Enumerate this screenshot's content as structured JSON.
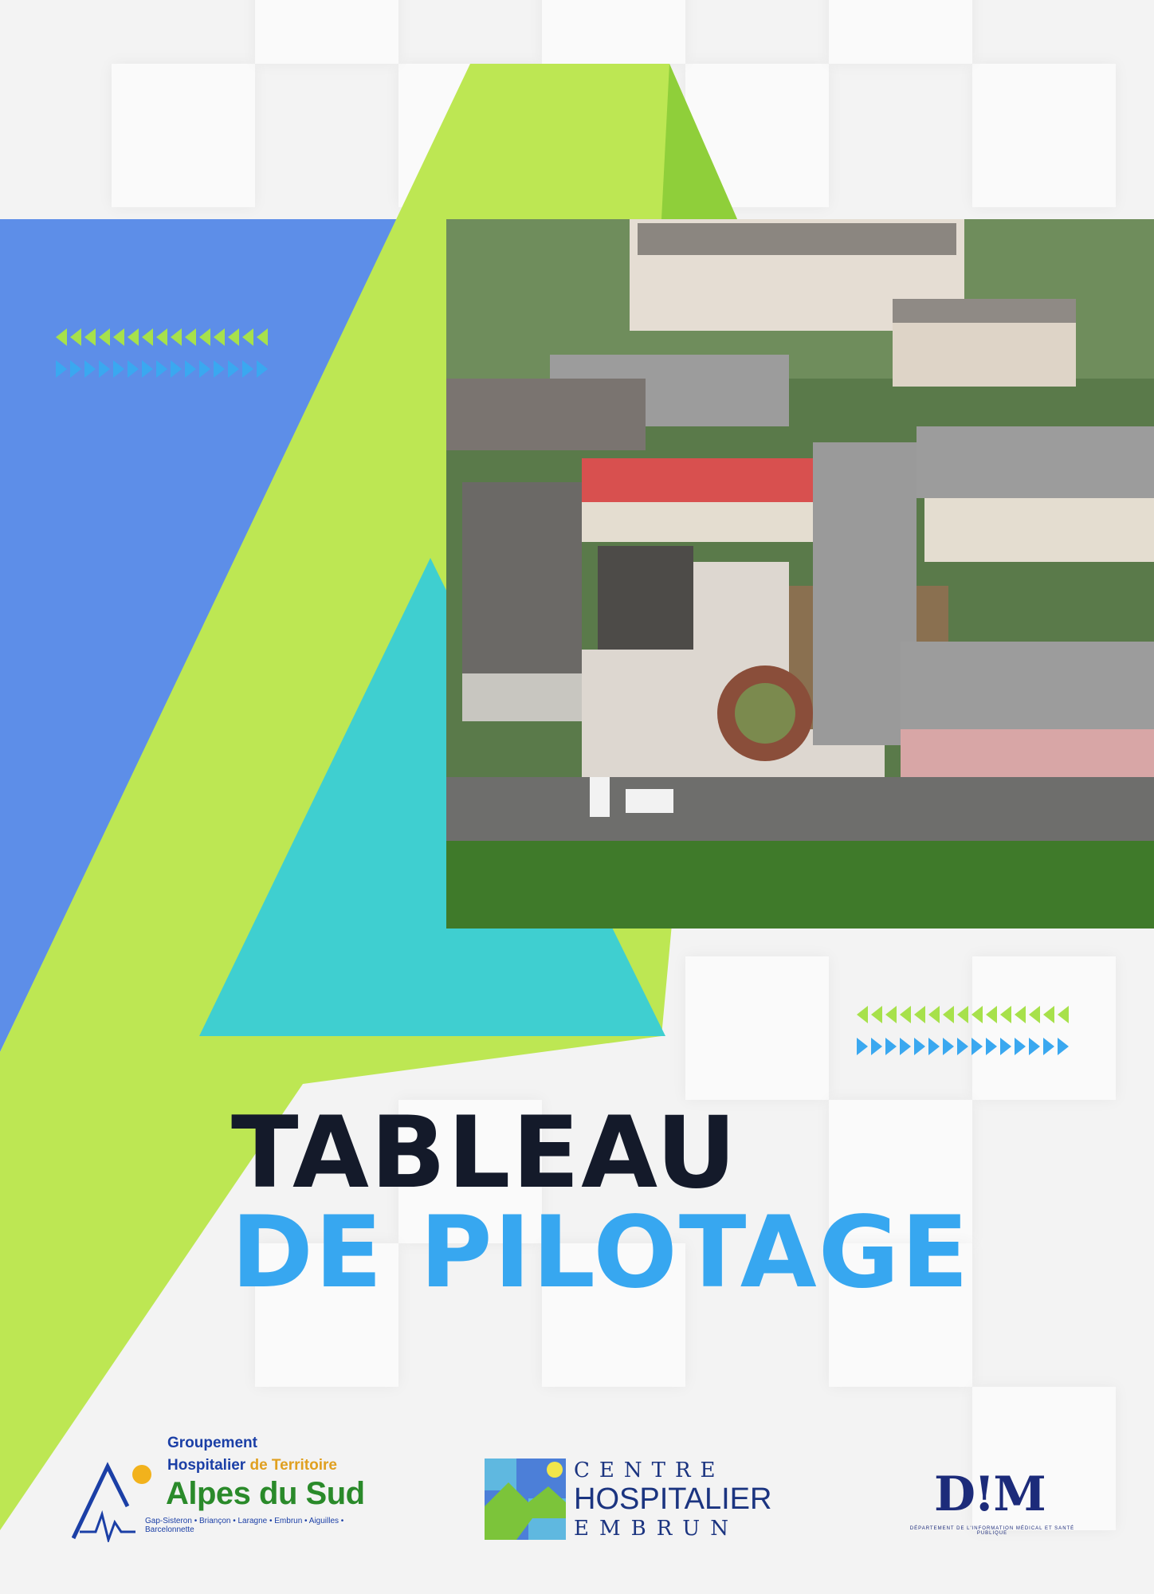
{
  "title": {
    "line1": "TABLEAU",
    "line2": "DE PILOTAGE"
  },
  "colors": {
    "blue_panel": "#5d8ee8",
    "lime": "#bde753",
    "teal": "#3fcfd0",
    "title_dark": "#141a2a",
    "title_blue": "#37a7f0",
    "arrow_green": "#a7e14b",
    "arrow_blue": "#3aa8f0"
  },
  "photo": {
    "description_icon": "hospital-aerial-photo"
  },
  "logos": {
    "ght": {
      "line1": "Groupement",
      "line2a": "Hospitalier",
      "line2b": " de Territoire",
      "line3": "Alpes du Sud",
      "line4": "Gap-Sisteron • Briançon • Laragne • Embrun • Aiguilles • Barcelonnette"
    },
    "ch": {
      "line1": "CENTRE",
      "line2": "HOSPITALIER",
      "line3": "EMBRUN"
    },
    "dim": {
      "abbr": "D!M",
      "subtitle": "DÉPARTEMENT DE L'INFORMATION MÉDICAL ET SANTÉ PUBLIQUE"
    }
  }
}
